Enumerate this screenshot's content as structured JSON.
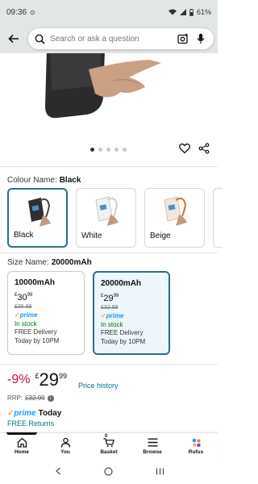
{
  "status": {
    "time": "09:36",
    "battery": "61%"
  },
  "search": {
    "placeholder": "Search or ask a question"
  },
  "carousel": {
    "dot_count": 5,
    "active_index": 0
  },
  "colour": {
    "label": "Colour Name:",
    "selected": "Black",
    "options": [
      {
        "name": "Black",
        "selected": true
      },
      {
        "name": "White",
        "selected": false
      },
      {
        "name": "Beige",
        "selected": false
      }
    ]
  },
  "size": {
    "label": "Size Name:",
    "selected": "20000mAh",
    "options": [
      {
        "name": "10000mAh",
        "currency": "£",
        "price_whole": "30",
        "price_fraction": "99",
        "was": "£36.99",
        "prime": "prime",
        "stock": "In stock",
        "delivery_line1": "FREE Delivery",
        "delivery_line2": "Today by 10PM",
        "selected": false
      },
      {
        "name": "20000mAh",
        "currency": "£",
        "price_whole": "29",
        "price_fraction": "99",
        "was": "£32.99",
        "prime": "prime",
        "stock": "In stock",
        "delivery_line1": "FREE Delivery",
        "delivery_line2": "Today by 10PM",
        "selected": true
      }
    ]
  },
  "price": {
    "discount": "-9%",
    "currency": "£",
    "whole": "29",
    "fraction": "99",
    "history_link": "Price history",
    "rrp_label": "RRP:",
    "rrp_value": "£32.99"
  },
  "delivery": {
    "prime": "prime",
    "today": "Today",
    "returns": "FREE Returns"
  },
  "bottom_nav": {
    "items": [
      {
        "label": "Home",
        "icon": "home-icon"
      },
      {
        "label": "You",
        "icon": "user-icon"
      },
      {
        "label": "Basket",
        "icon": "basket-icon",
        "count": "0"
      },
      {
        "label": "Browse",
        "icon": "menu-icon"
      },
      {
        "label": "Rufus",
        "icon": "rufus-icon"
      }
    ]
  },
  "colors": {
    "link": "#007185",
    "discount": "#cc0c39",
    "prime": "#1a98ff",
    "stock": "#007600",
    "selected_border": "#2a6f8a"
  }
}
